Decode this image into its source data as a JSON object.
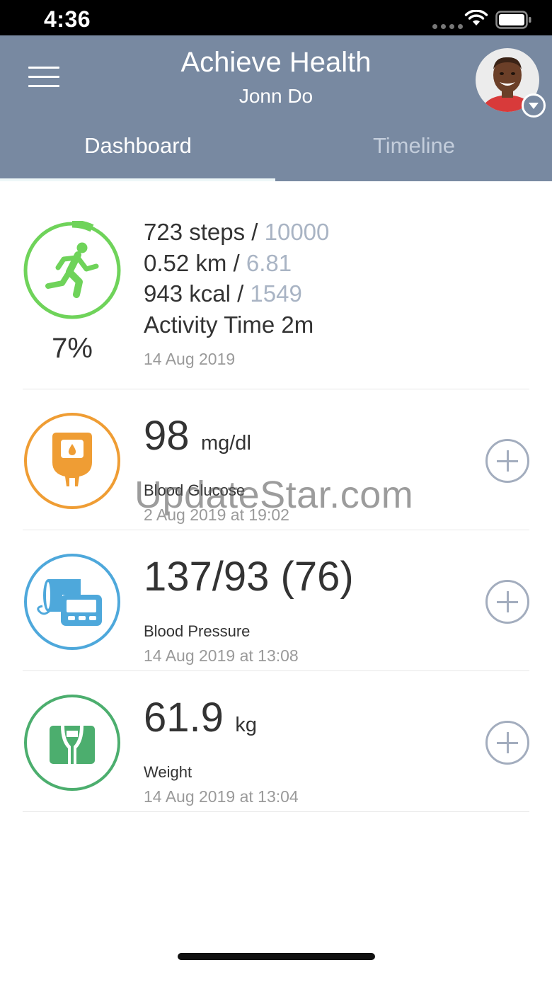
{
  "status_bar": {
    "time": "4:36"
  },
  "header": {
    "title": "Achieve Health",
    "user_name": "Jonn Do",
    "tabs": [
      {
        "label": "Dashboard",
        "active": true
      },
      {
        "label": "Timeline",
        "active": false
      }
    ]
  },
  "activity": {
    "percent": "7%",
    "progress_fraction": 0.07,
    "steps": "723 steps / ",
    "steps_goal": "10000",
    "distance": "0.52 km / ",
    "distance_goal": "6.81",
    "energy": "943 kcal / ",
    "energy_goal": "1549",
    "activity_time": "Activity Time 2m",
    "date": "14 Aug 2019",
    "icon": "running-person-icon",
    "color": "#6fd35a"
  },
  "blood_glucose": {
    "value": "98",
    "unit": "mg/dl",
    "label": "Blood Glucose",
    "date": "2 Aug 2019 at 19:02",
    "icon": "glucose-meter-icon",
    "color": "#ef9d34"
  },
  "blood_pressure": {
    "value": "137/93 (76)",
    "label": "Blood Pressure",
    "date": "14 Aug 2019 at 13:08",
    "icon": "blood-pressure-monitor-icon",
    "color": "#4ea8db"
  },
  "weight": {
    "value": "61.9",
    "unit": "kg",
    "label": "Weight",
    "date": "14 Aug 2019 at 13:04",
    "icon": "scale-icon",
    "color": "#4cae6e"
  },
  "watermark": "UpdateStar.com",
  "colors": {
    "header_bg": "#7889a1",
    "plus": "#a3adbe"
  }
}
